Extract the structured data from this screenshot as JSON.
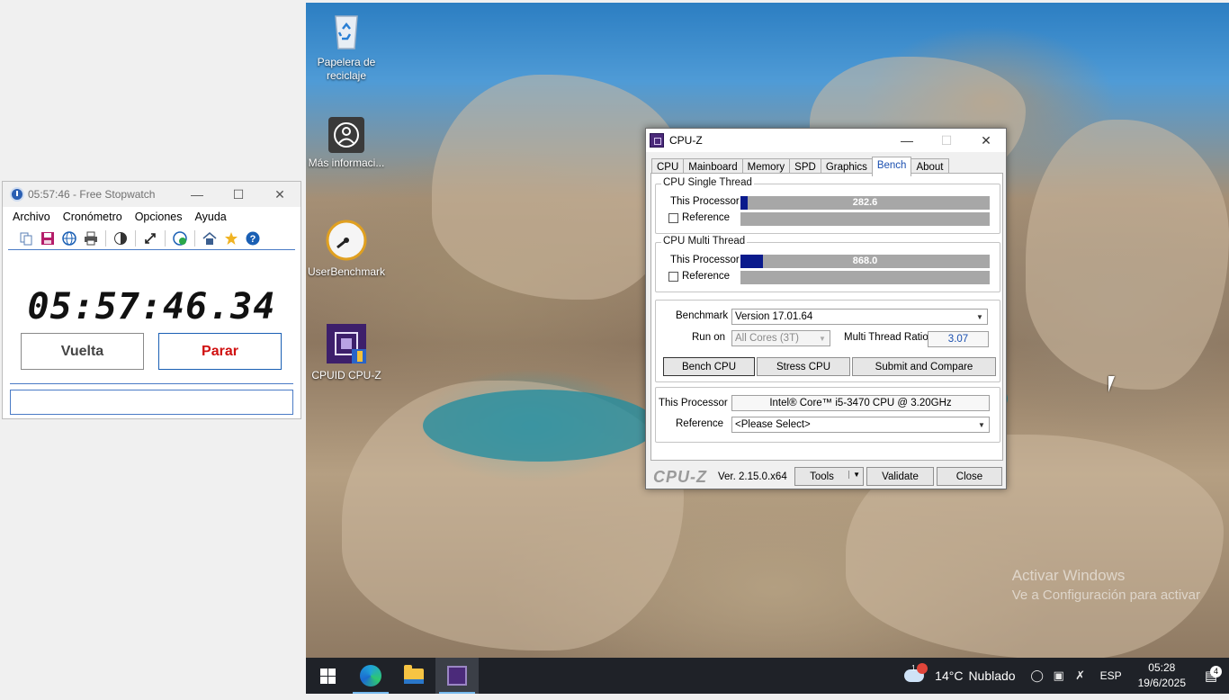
{
  "desktop": {
    "icons": [
      {
        "label": "Papelera de reciclaje",
        "icon": "recycle-bin-icon"
      },
      {
        "label": "Más informaci...",
        "icon": "info-icon"
      },
      {
        "label": "UserBenchmark",
        "icon": "speedometer-icon"
      },
      {
        "label": "CPUID CPU-Z",
        "icon": "cpu-chip-icon"
      }
    ],
    "watermark": {
      "title": "Activar Windows",
      "subtitle": "Ve a Configuración para activar"
    }
  },
  "stopwatch": {
    "title": "05:57:46 - Free Stopwatch",
    "menu": [
      "Archivo",
      "Cronómetro",
      "Opciones",
      "Ayuda"
    ],
    "toolbar_icons": [
      "copy-icon",
      "save-icon",
      "globe-icon",
      "print-icon",
      "contrast-icon",
      "fullscreen-icon",
      "web-update-icon",
      "home-icon",
      "star-icon",
      "help-icon"
    ],
    "time": "05:57:46.34",
    "lap_label": "Vuelta",
    "stop_label": "Parar",
    "notes_value": ""
  },
  "cpuz": {
    "title": "CPU-Z",
    "tabs": [
      "CPU",
      "Mainboard",
      "Memory",
      "SPD",
      "Graphics",
      "Bench",
      "About"
    ],
    "active_tab": "Bench",
    "single_thread": {
      "title": "CPU Single Thread",
      "this_processor_label": "This Processor",
      "this_processor_value": "282.6",
      "this_processor_fraction": 0.03,
      "reference_label": "Reference"
    },
    "multi_thread": {
      "title": "CPU Multi Thread",
      "this_processor_label": "This Processor",
      "this_processor_value": "868.0",
      "this_processor_fraction": 0.09,
      "reference_label": "Reference"
    },
    "benchmark_label": "Benchmark",
    "benchmark_value": "Version 17.01.64",
    "run_on_label": "Run on",
    "run_on_value": "All Cores (3T)",
    "ratio_label": "Multi Thread Ratio",
    "ratio_value": "3.07",
    "bench_cpu_label": "Bench CPU",
    "stress_cpu_label": "Stress CPU",
    "submit_label": "Submit and Compare",
    "processor_label": "This Processor",
    "processor_value": "Intel® Core™ i5-3470 CPU @ 3.20GHz",
    "reference_label": "Reference",
    "reference_value": "<Please Select>",
    "brand": "CPU-Z",
    "version": "Ver. 2.15.0.x64",
    "tools_label": "Tools",
    "validate_label": "Validate",
    "close_label": "Close",
    "bar_color": "#0a1a8c"
  },
  "taskbar": {
    "weather_temp": "14°C",
    "weather_text": "Nublado",
    "weather_badge": "1",
    "language": "ESP",
    "time": "05:28",
    "date": "19/6/2025",
    "notifications": "4"
  }
}
